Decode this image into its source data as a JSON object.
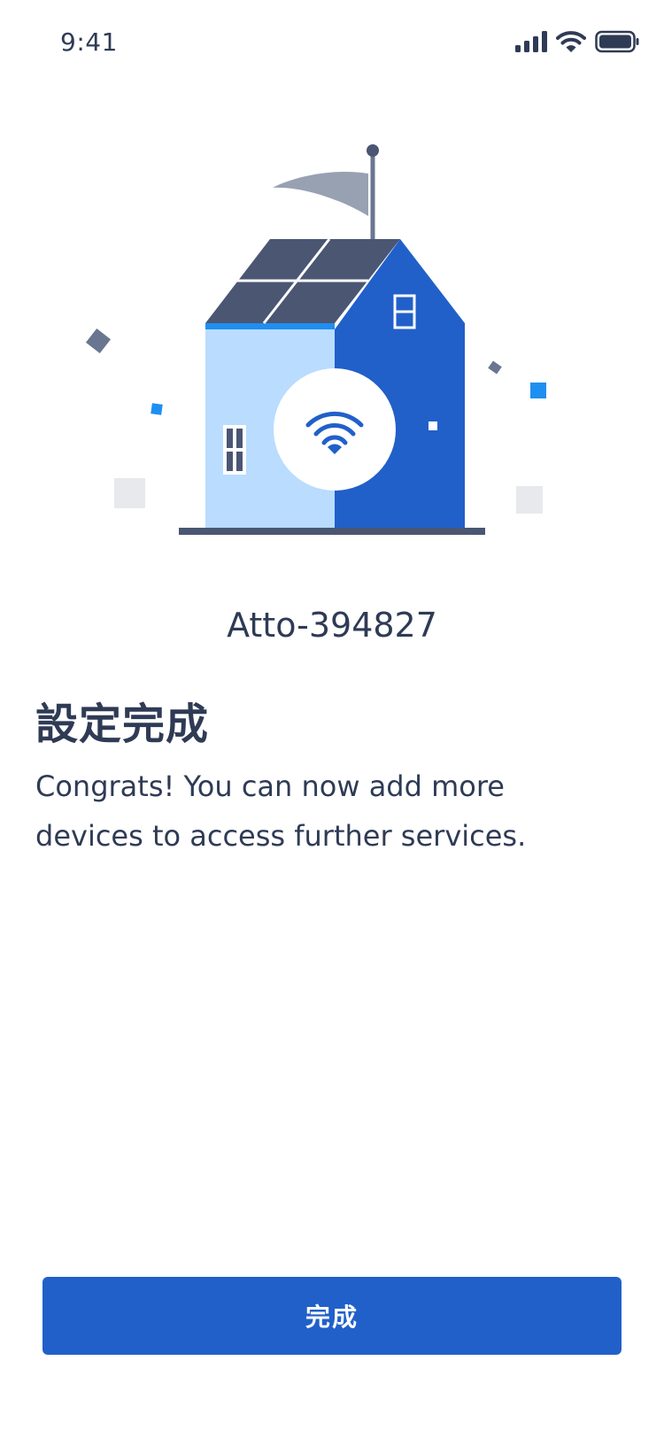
{
  "status_bar": {
    "time": "9:41",
    "icons": [
      "cellular-signal-icon",
      "wifi-icon",
      "battery-icon"
    ]
  },
  "illustration": {
    "subject": "house-with-wifi-illustration",
    "colors": {
      "roof": "#4b5673",
      "wall_left": "#b9dcff",
      "wall_right": "#2160c9",
      "flag": "#98a1b1",
      "confetti_blue": "#1f8ef1",
      "confetti_gray": "#e8e9ec"
    }
  },
  "device": {
    "name": "Atto-394827"
  },
  "content": {
    "title": "設定完成",
    "message": "Congrats! You can now add more devices to access further services."
  },
  "actions": {
    "done_label": "完成"
  },
  "colors": {
    "text_primary": "#2f3b55",
    "accent": "#2160c9",
    "background": "#ffffff"
  }
}
